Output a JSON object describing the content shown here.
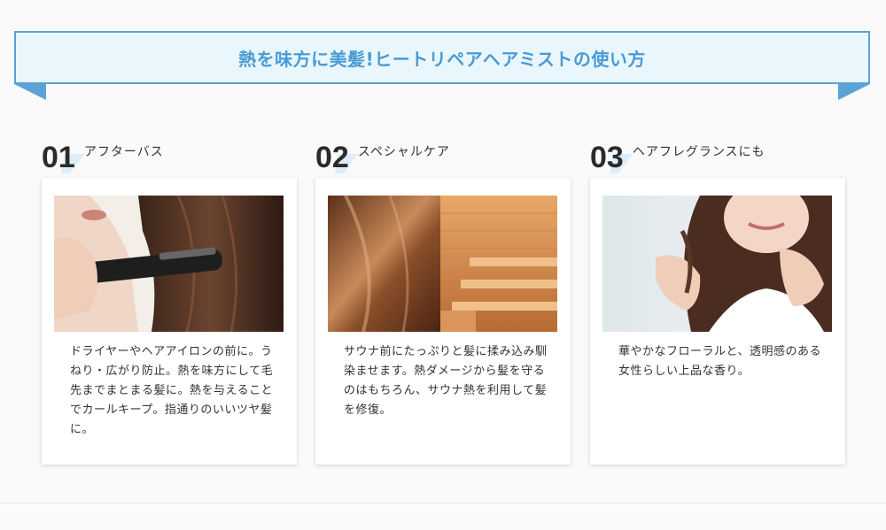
{
  "banner": {
    "title": "熱を味方に美髪!ヒートリペアヘアミストの使い方"
  },
  "colors": {
    "accent": "#4a9bd6",
    "banner_bg": "#e9f7fc",
    "ribbon": "#5ba3d6"
  },
  "steps": [
    {
      "number": "01",
      "label": "アフターバス",
      "image": "woman-using-hair-iron-photo",
      "text": "ドライヤーやヘアアイロンの前に。うねり・広がり防止。熱を味方にして毛先までまとまる髪に。熱を与えることでカールキープ。指通りのいいツヤ髪に。"
    },
    {
      "number": "02",
      "label": "スペシャルケア",
      "image": "glossy-hair-and-sauna-photo",
      "text": "サウナ前にたっぷりと髪に揉み込み馴染ませます。熱ダメージから髪を守るのはもちろん、サウナ熱を利用して髪を修復。"
    },
    {
      "number": "03",
      "label": "ヘアフレグランスにも",
      "image": "woman-touching-hair-photo",
      "text": "華やかなフローラルと、透明感のある女性らしい上品な香り。"
    }
  ]
}
